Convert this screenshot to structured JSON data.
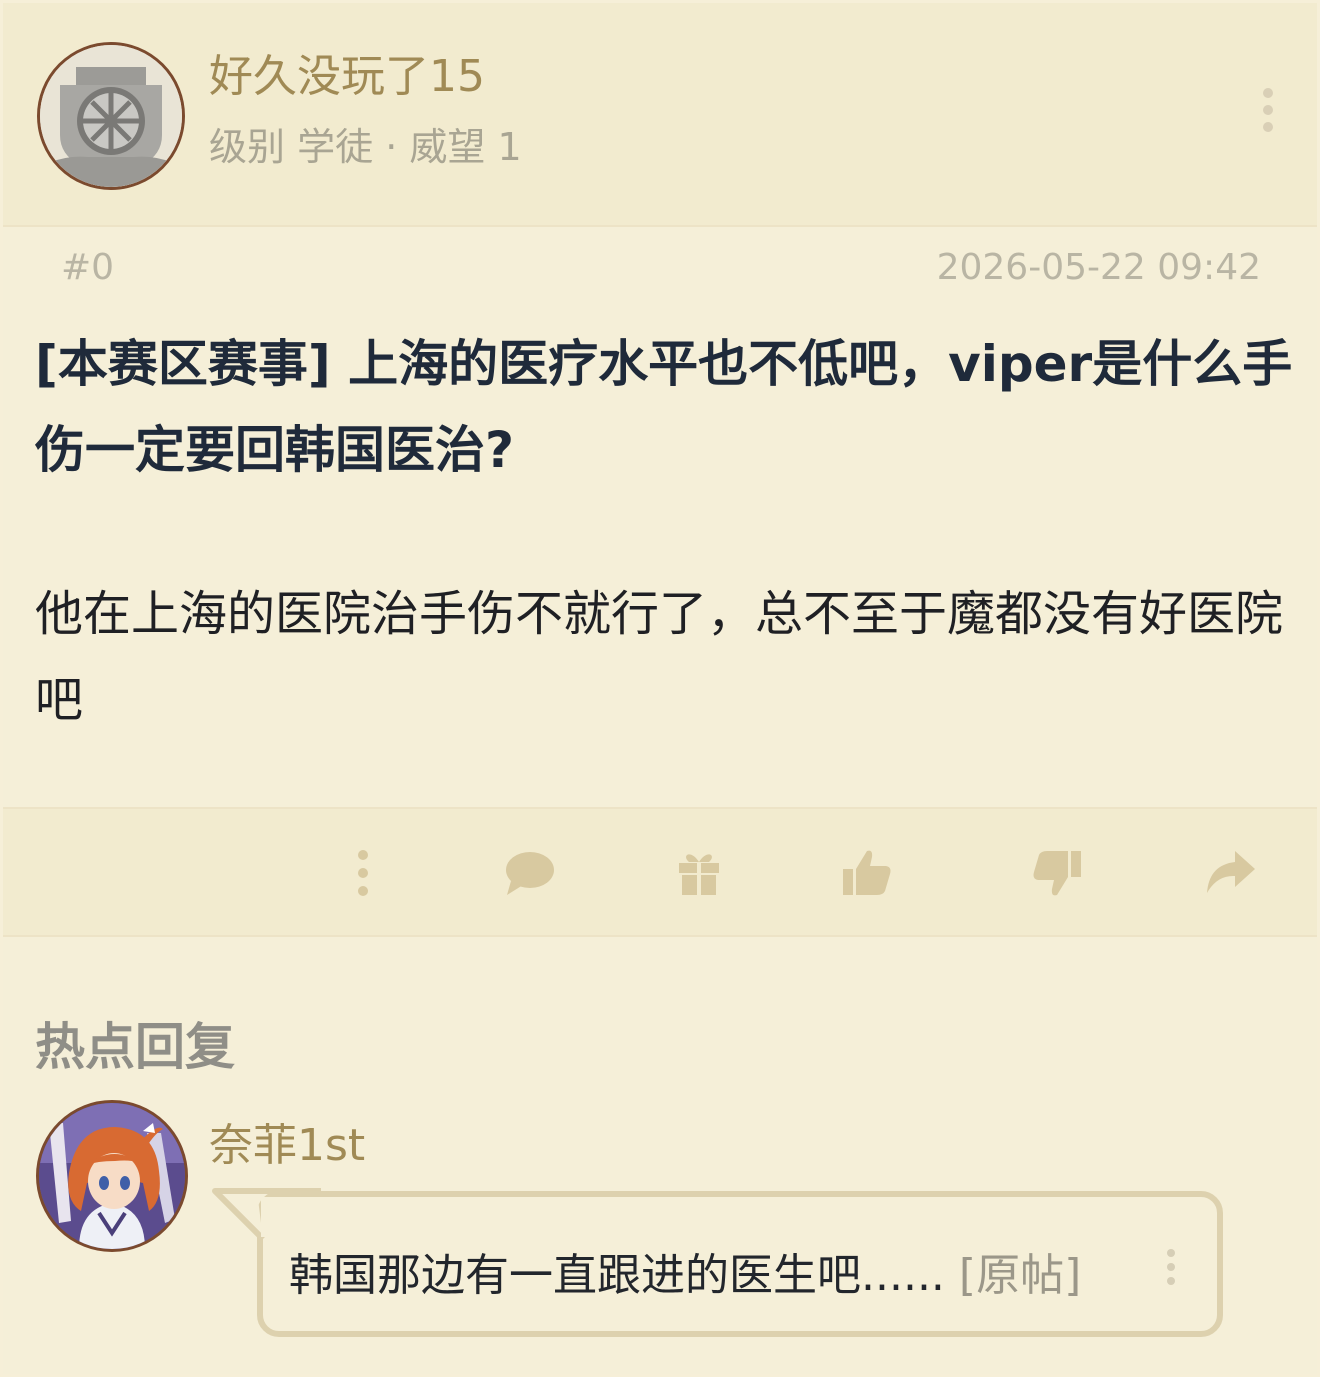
{
  "post": {
    "author": {
      "name": "好久没玩了15",
      "level_label": "级别",
      "level": "学徒",
      "dot": "·",
      "prestige_label": "威望",
      "prestige": "1",
      "avatar": "diving-helmet-avatar"
    },
    "floor": "#0",
    "date": "2026-05-22 09:42",
    "title": "[本赛区赛事] 上海的医疗水平也不低吧，viper是什么手伤一定要回韩国医治?",
    "content": "他在上海的医院治手伤不就行了，总不至于魔都没有好医院吧"
  },
  "actions": [
    "more-vertical-icon",
    "comment-icon",
    "gift-icon",
    "thumbs-up-icon",
    "thumbs-down-icon",
    "share-icon"
  ],
  "hot_replies": {
    "heading": "热点回复",
    "items": [
      {
        "name": "奈菲1st",
        "avatar": "anime-girl-avatar",
        "text": "韩国那边有一直跟进的医生吧......",
        "original_link": "[原帖]"
      }
    ]
  },
  "colors": {
    "background": "#f5efd8",
    "header_bg": "#f2ebcf",
    "username": "#a08a55",
    "title": "#1f2a3a",
    "icon": "#d8c9a0"
  }
}
